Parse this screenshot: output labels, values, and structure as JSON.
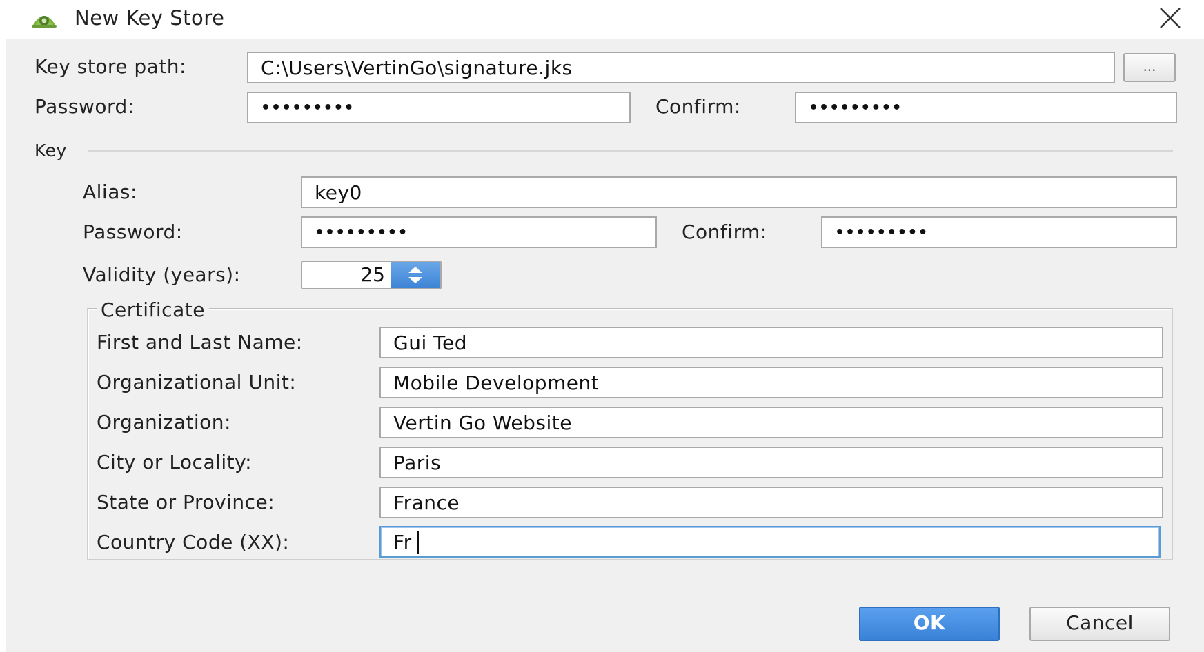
{
  "window": {
    "title": "New Key Store",
    "app_icon": "android-studio-icon",
    "close_icon": "close-icon"
  },
  "keystore": {
    "path_label": "Key store path:",
    "path_value": "C:\\Users\\VertinGo\\signature.jks",
    "browse_label": "...",
    "password_label": "Password:",
    "password_value": "•••••••••",
    "confirm_label": "Confirm:",
    "confirm_value": "•••••••••"
  },
  "key": {
    "section_label": "Key",
    "alias_label": "Alias:",
    "alias_value": "key0",
    "password_label": "Password:",
    "password_value": "•••••••••",
    "confirm_label": "Confirm:",
    "confirm_value": "•••••••••",
    "validity_label": "Validity (years):",
    "validity_value": "25"
  },
  "certificate": {
    "section_label": "Certificate",
    "fields": [
      {
        "label": "First and Last Name:",
        "value": "Gui Ted"
      },
      {
        "label": "Organizational Unit:",
        "value": "Mobile Development"
      },
      {
        "label": "Organization:",
        "value": "Vertin Go Website"
      },
      {
        "label": "City or Locality:",
        "value": "Paris"
      },
      {
        "label": "State or Province:",
        "value": "France"
      },
      {
        "label": "Country Code (XX):",
        "value": "Fr"
      }
    ]
  },
  "buttons": {
    "ok_label": "OK",
    "cancel_label": "Cancel"
  },
  "colors": {
    "accent": "#3a82d8",
    "dialog_background": "#f0f0f0",
    "focus_border": "#5b9bd5"
  }
}
